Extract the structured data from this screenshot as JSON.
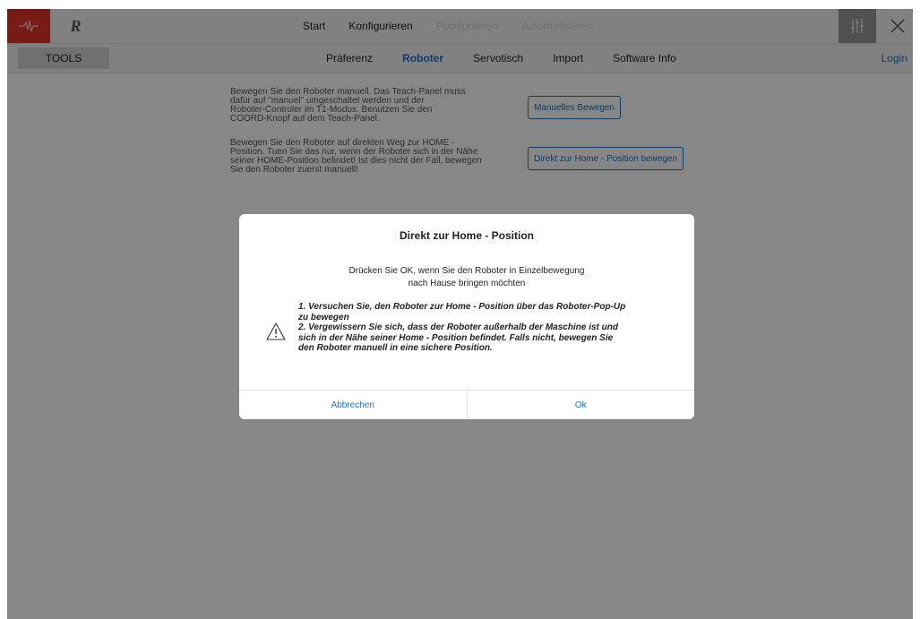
{
  "topbar": {
    "brand_label": "R",
    "nav": [
      {
        "label": "Start",
        "disabled": false
      },
      {
        "label": "Konfigurieren",
        "disabled": false
      },
      {
        "label": "Positionieren",
        "disabled": true
      },
      {
        "label": "Automatisieren",
        "disabled": true
      }
    ],
    "icons": {
      "logo": "pulse-logo-icon",
      "settings": "sliders-icon",
      "close": "close-icon"
    },
    "colors": {
      "logo_bg": "#e0342c",
      "sliders_bg": "#9a9a9a"
    }
  },
  "subbar": {
    "tools_label": "TOOLS",
    "tabs": [
      {
        "label": "Präferenz",
        "active": false
      },
      {
        "label": "Roboter",
        "active": true
      },
      {
        "label": "Servotisch",
        "active": false
      },
      {
        "label": "Import",
        "active": false
      },
      {
        "label": "Software Info",
        "active": false
      }
    ],
    "login_label": "Login",
    "colors": {
      "active": "#1a73c9"
    }
  },
  "content": {
    "manual": {
      "lines": [
        "Bewegen Sie den Roboter manuell.  Das Teach-Panel muss",
        "dafür auf \"manuel\" umgeschaltet werden und der",
        "Roboter-Controler im T1-Modus. Benutzen Sie den",
        "COORD-Knopf auf dem Teach-Panel."
      ],
      "button_label": "Manuelles Bewegen"
    },
    "home": {
      "lines": [
        "Bewegen Sie den Roboter auf direkten Weg zur HOME -",
        "Position. Tuen Sie das nur, wenn der Roboter sich in der Nähe",
        "seiner HOME-Position befindet! Ist dies nicht der Fall, bewegen",
        "Sie den Roboter zuerst manuell!"
      ],
      "button_label": "Direkt zur Home - Position bewegen"
    }
  },
  "dialog": {
    "title": "Direkt zur Home - Position",
    "message_lines": [
      "Drücken Sie OK, wenn Sie den Roboter in Einzelbewegung",
      "nach Hause bringen möchten"
    ],
    "warning_lines": [
      "1. Versuchen Sie, den Roboter zur Home - Position über das Roboter-Pop-Up",
      "zu bewegen",
      "2. Vergewissern Sie sich, dass der Roboter außerhalb der Maschine ist und",
      "sich in der Nähe seiner Home - Position befindet. Falls nicht, bewegen Sie",
      "den Roboter manuell in eine sichere Position."
    ],
    "warning_icon": "warning-triangle-icon",
    "cancel_label": "Abbrechen",
    "ok_label": "Ok"
  }
}
